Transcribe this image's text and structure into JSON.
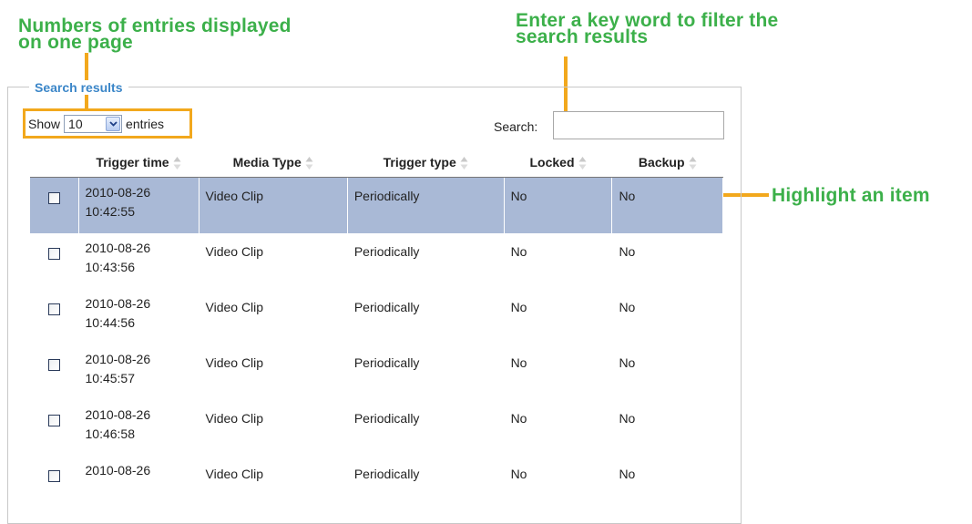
{
  "callouts": {
    "entries_line1": "Numbers of entries displayed",
    "entries_line2": "on one page",
    "search_line1": "Enter a key word to filter the",
    "search_line2": "search results",
    "highlight": "Highlight an item"
  },
  "panel": {
    "legend": "Search results",
    "show_label": "Show",
    "entries_value": "10",
    "entries_label": "entries",
    "search_label": "Search:",
    "search_value": ""
  },
  "table": {
    "headers": [
      "Trigger time",
      "Media Type",
      "Trigger type",
      "Locked",
      "Backup"
    ],
    "rows": [
      {
        "date": "2010-08-26",
        "time": "10:42:55",
        "media": "Video Clip",
        "trigger": "Periodically",
        "locked": "No",
        "backup": "No",
        "highlighted": true
      },
      {
        "date": "2010-08-26",
        "time": "10:43:56",
        "media": "Video Clip",
        "trigger": "Periodically",
        "locked": "No",
        "backup": "No"
      },
      {
        "date": "2010-08-26",
        "time": "10:44:56",
        "media": "Video Clip",
        "trigger": "Periodically",
        "locked": "No",
        "backup": "No"
      },
      {
        "date": "2010-08-26",
        "time": "10:45:57",
        "media": "Video Clip",
        "trigger": "Periodically",
        "locked": "No",
        "backup": "No"
      },
      {
        "date": "2010-08-26",
        "time": "10:46:58",
        "media": "Video Clip",
        "trigger": "Periodically",
        "locked": "No",
        "backup": "No"
      },
      {
        "date": "2010-08-26",
        "time": "",
        "media": "Video Clip",
        "trigger": "Periodically",
        "locked": "No",
        "backup": "No"
      }
    ]
  },
  "colors": {
    "callout_text": "#3cb04a",
    "leader_line": "#f2a81d",
    "legend_text": "#3b86c8",
    "highlight_row": "#a9b9d6"
  }
}
